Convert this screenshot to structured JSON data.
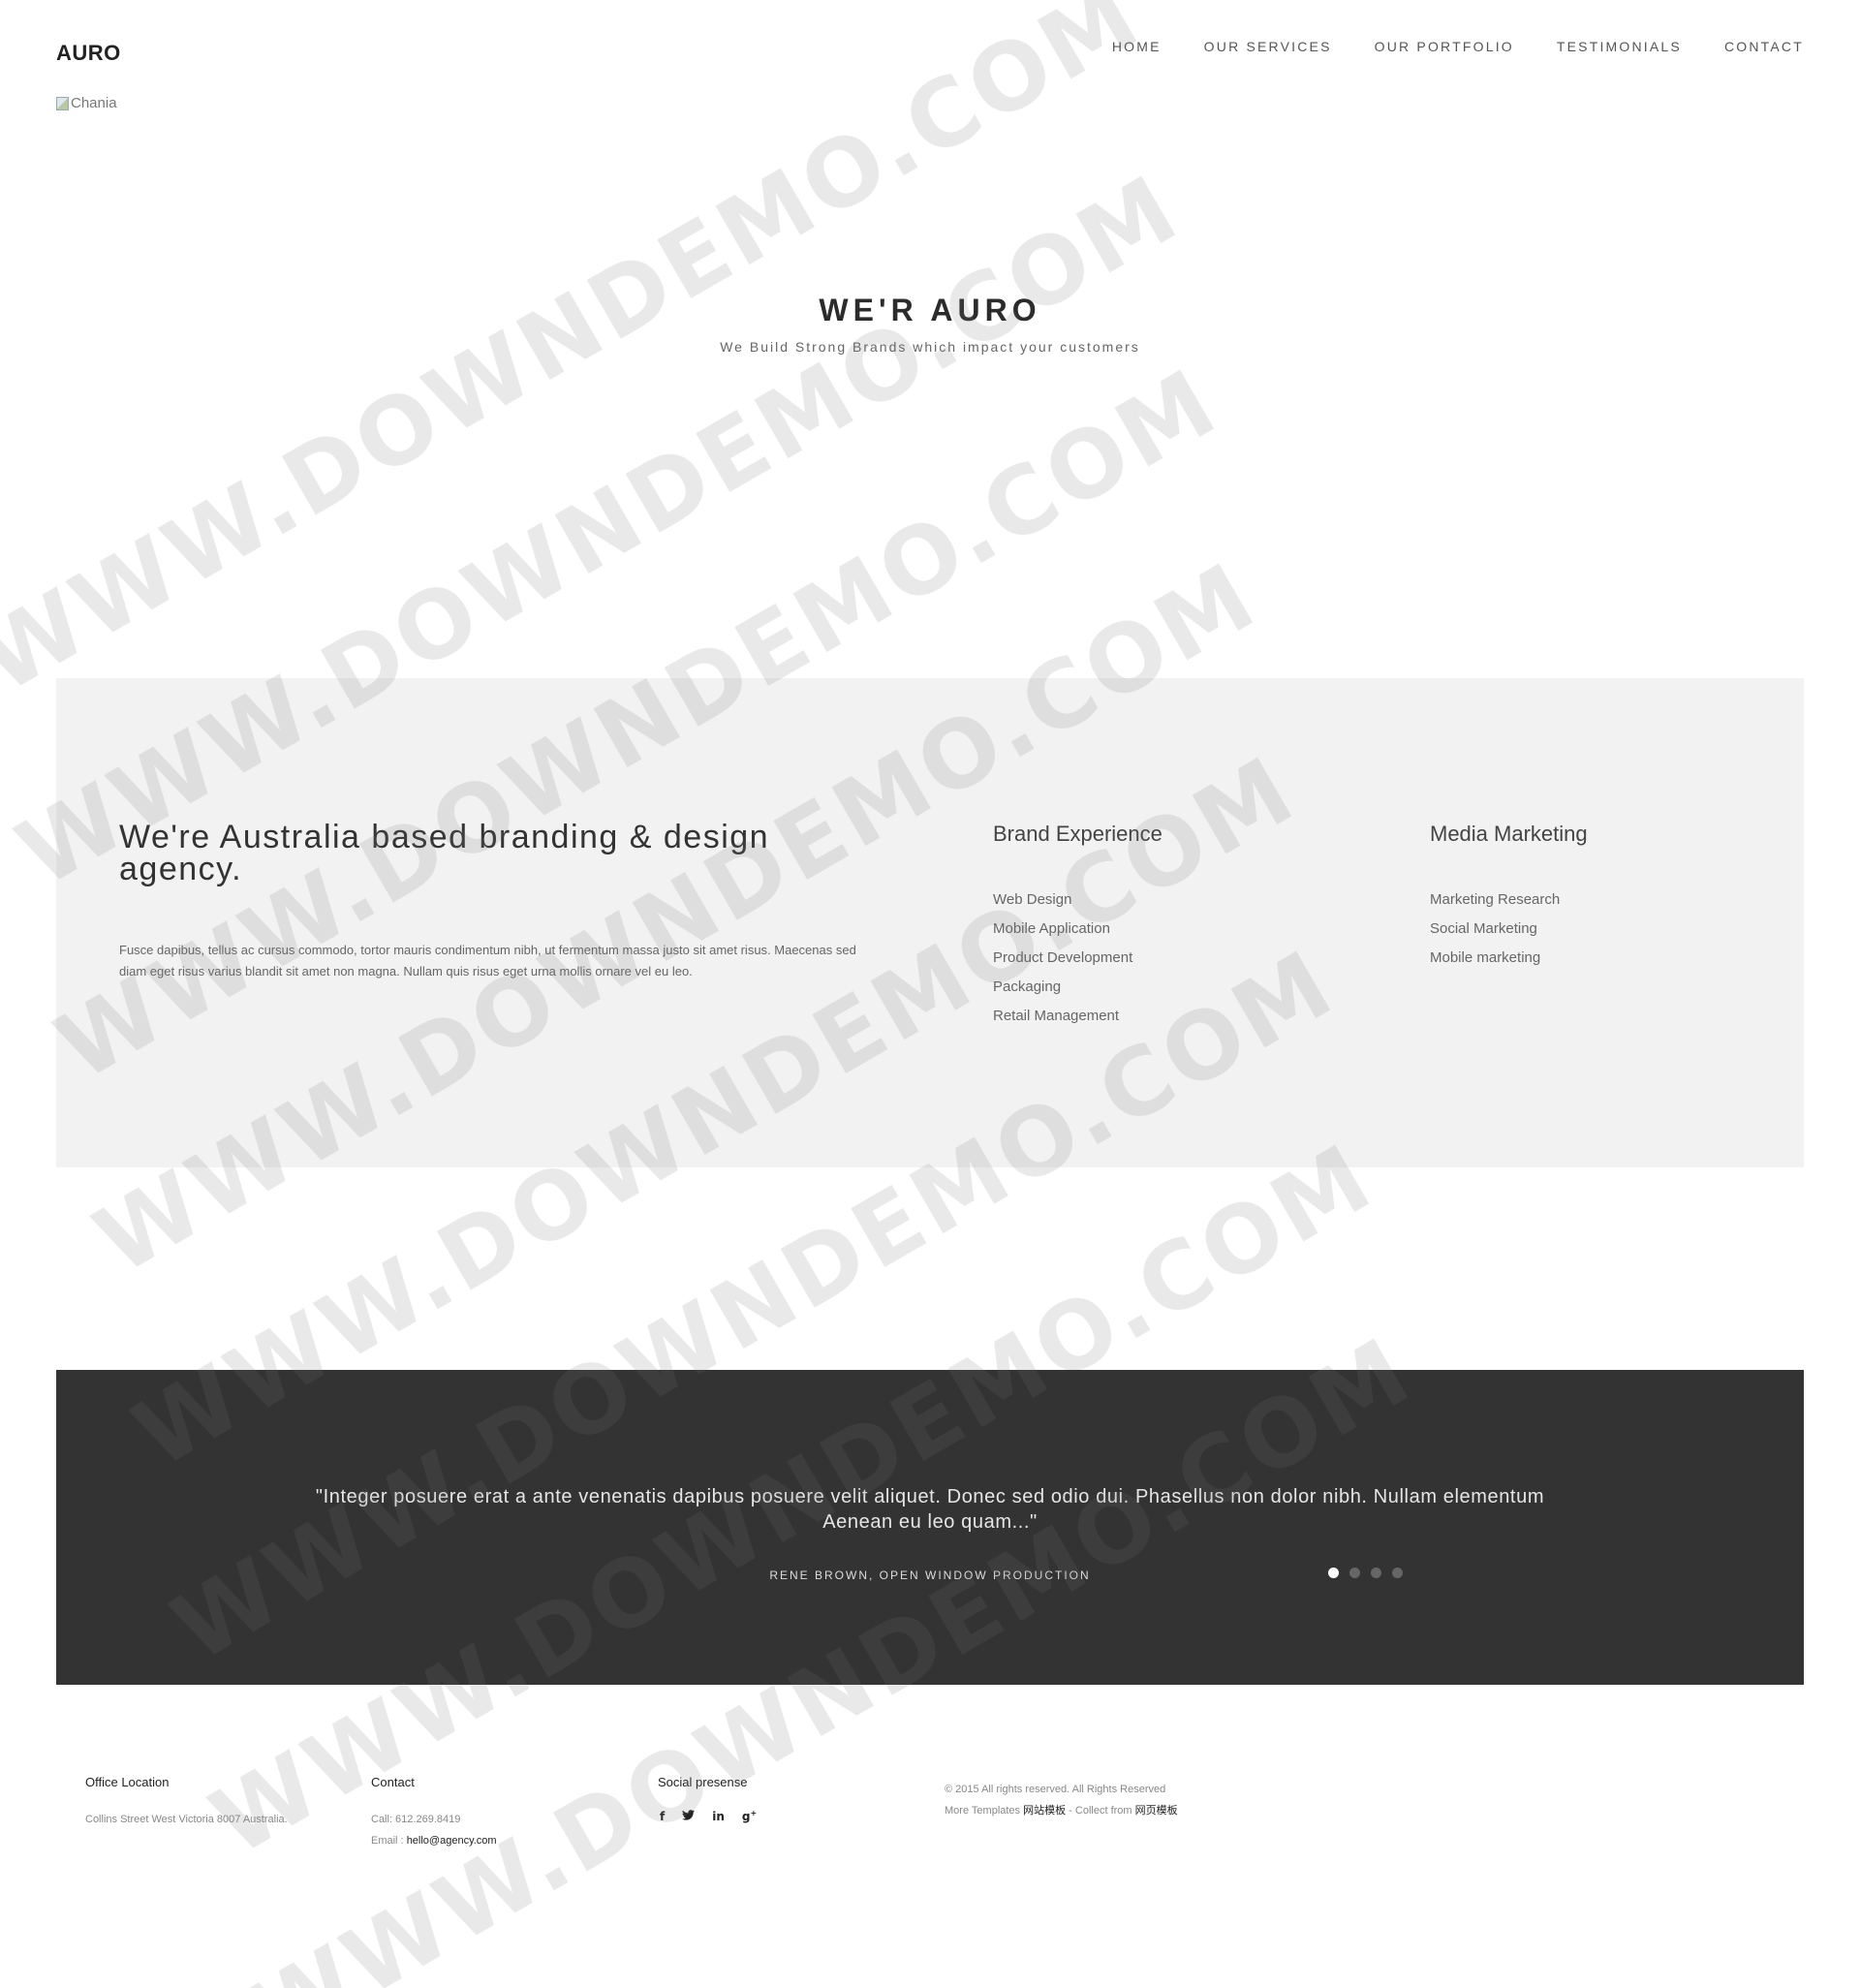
{
  "header": {
    "logo": "AURO",
    "nav": [
      "HOME",
      "OUR SERVICES",
      "OUR PORTFOLIO",
      "TESTIMONIALS",
      "CONTACT"
    ],
    "image_alt": "Chania"
  },
  "hero": {
    "title": "WE'R AURO",
    "subtitle": "We Build Strong Brands which impact your customers"
  },
  "about": {
    "heading": "We're Australia based branding & design agency.",
    "body": "Fusce dapibus, tellus ac cursus commodo, tortor mauris condimentum nibh, ut fermentum massa justo sit amet risus. Maecenas sed diam eget risus varius blandit sit amet non magna. Nullam quis risus eget urna mollis ornare vel eu leo.",
    "brand": {
      "title": "Brand Experience",
      "items": [
        "Web Design",
        "Mobile Application",
        "Product Development",
        "Packaging",
        "Retail Management"
      ]
    },
    "media": {
      "title": "Media Marketing",
      "items": [
        "Marketing Research",
        "Social Marketing",
        "Mobile marketing"
      ]
    }
  },
  "testimonial": {
    "quote_line1": "\"Integer posuere erat a ante venenatis dapibus posuere velit aliquet. Donec sed odio dui. Phasellus non dolor nibh. Nullam elementum",
    "quote_line2": "Aenean eu leo quam...\"",
    "author": "RENE BROWN, OPEN WINDOW PRODUCTION",
    "slide_count": 4,
    "active_slide": 1
  },
  "footer": {
    "office": {
      "title": "Office Location",
      "address": "Collins Street West Victoria 8007 Australia."
    },
    "contact": {
      "title": "Contact",
      "call": "Call: 612.269.8419",
      "email_label": "Email : ",
      "email": "hello@agency.com"
    },
    "social": {
      "title": "Social presense",
      "icons": [
        "facebook-icon",
        "twitter-icon",
        "linkedin-icon",
        "google-plus-icon"
      ]
    },
    "copyright": "© 2015 All rights reserved. All Rights Reserved",
    "more_prefix": "More Templates ",
    "more_link": "网站模板",
    "collect_prefix": " - Collect from ",
    "collect_link": "网页模板"
  },
  "watermark": "WWW.DOWNDEMO.COM"
}
